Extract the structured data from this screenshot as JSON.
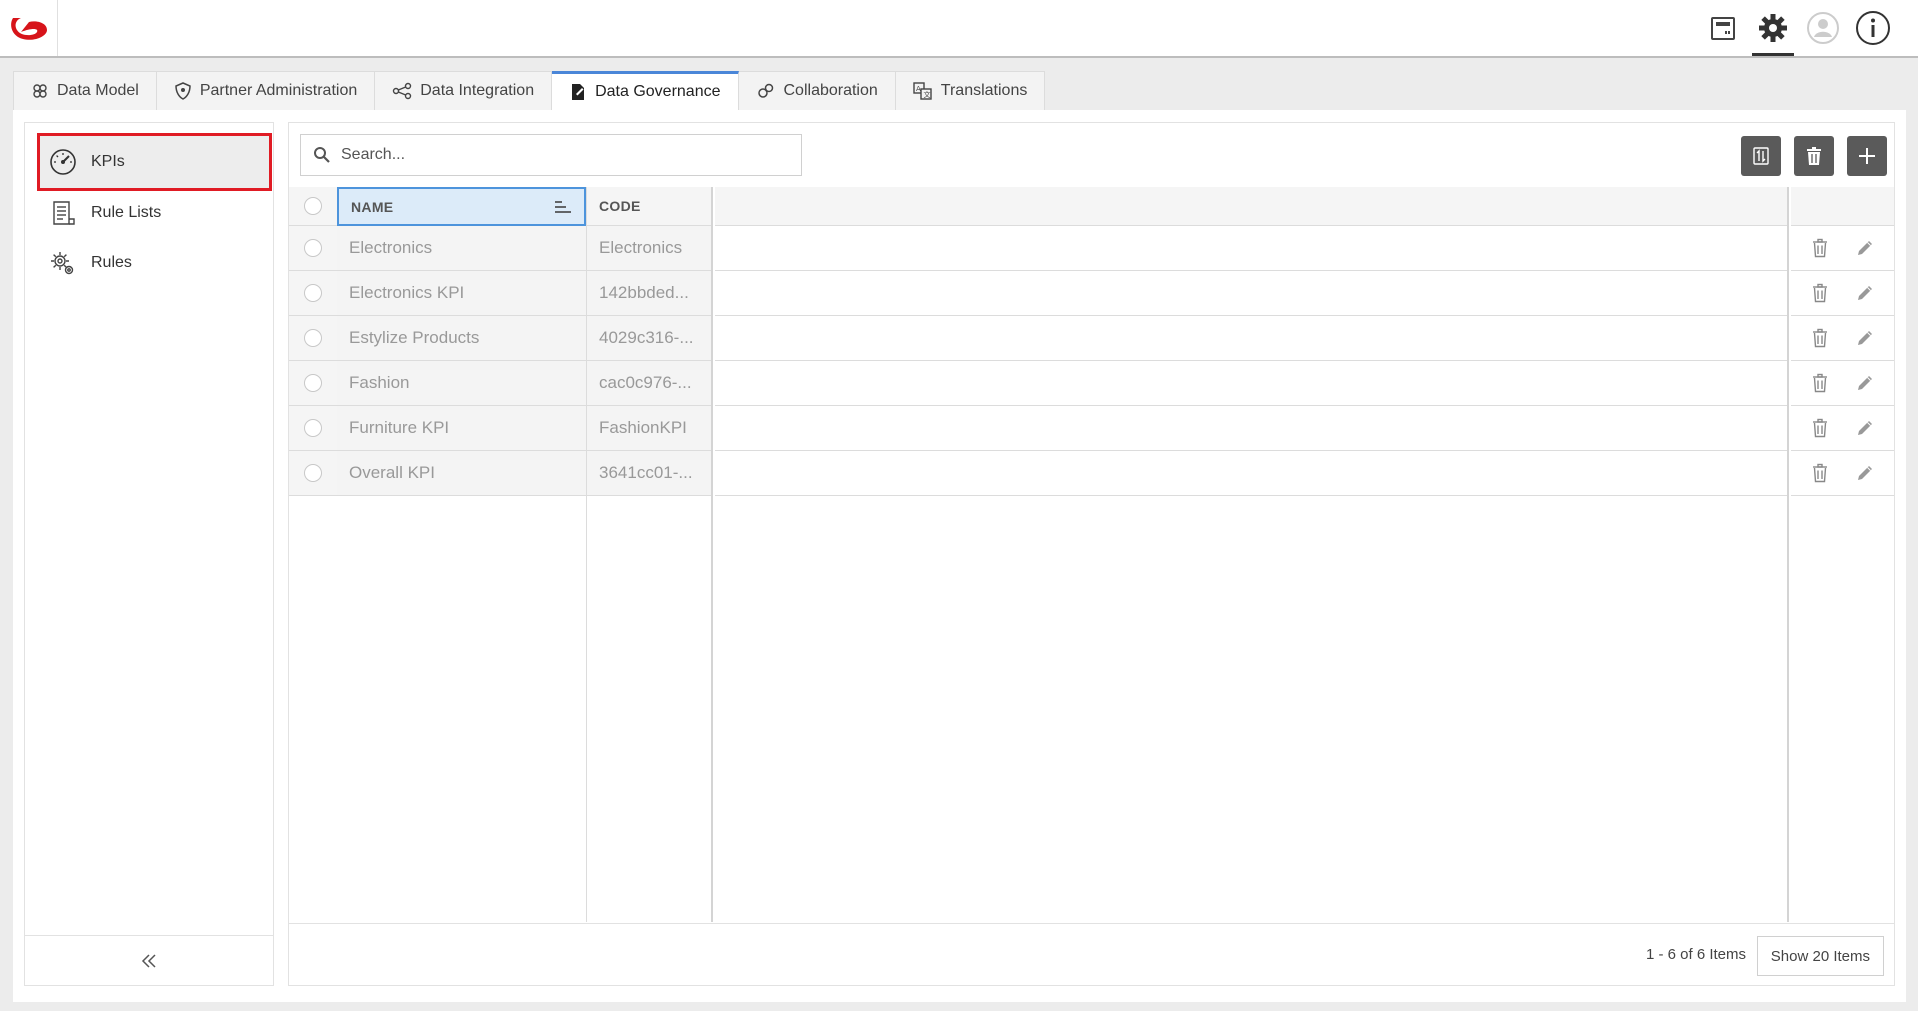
{
  "topbar": {
    "icons": [
      "calendar-icon",
      "gear-icon",
      "user-avatar-icon",
      "info-icon"
    ]
  },
  "tabs": [
    {
      "label": "Data Model",
      "icon": "data-model-icon"
    },
    {
      "label": "Partner Administration",
      "icon": "shield-icon"
    },
    {
      "label": "Data Integration",
      "icon": "integration-icon"
    },
    {
      "label": "Data Governance",
      "icon": "governance-icon",
      "active": true
    },
    {
      "label": "Collaboration",
      "icon": "collaboration-icon"
    },
    {
      "label": "Translations",
      "icon": "translations-icon"
    }
  ],
  "sidebar": {
    "items": [
      {
        "label": "KPIs",
        "icon": "gauge-icon",
        "active": true
      },
      {
        "label": "Rule Lists",
        "icon": "rule-list-icon"
      },
      {
        "label": "Rules",
        "icon": "rules-gear-icon"
      }
    ],
    "collapse_icon": "double-chevron-left-icon"
  },
  "search": {
    "placeholder": "Search..."
  },
  "grid": {
    "columns": {
      "name": "NAME",
      "code": "CODE"
    },
    "rows": [
      {
        "name": "Electronics",
        "code": "Electronics"
      },
      {
        "name": "Electronics KPI",
        "code": "142bbded..."
      },
      {
        "name": "Estylize Products",
        "code": "4029c316-..."
      },
      {
        "name": "Fashion",
        "code": "cac0c976-..."
      },
      {
        "name": "Furniture KPI",
        "code": "FashionKPI"
      },
      {
        "name": "Overall KPI",
        "code": "3641cc01-..."
      }
    ]
  },
  "footer": {
    "pager_text": "1 - 6 of 6 Items",
    "show_items_label": "Show 20 Items"
  },
  "colors": {
    "accent": "#4a86d8",
    "highlight": "#e01b24",
    "logo": "#d7141a"
  }
}
